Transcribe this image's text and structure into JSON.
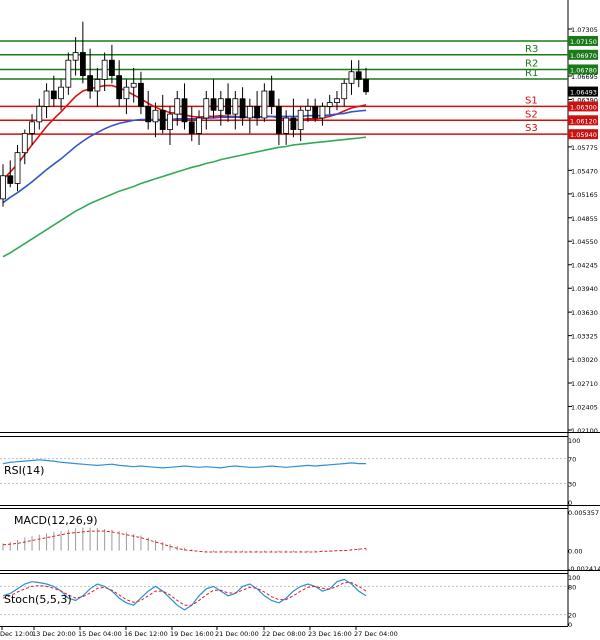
{
  "chart_data": {
    "type": "candlestick",
    "price_axis": {
      "ticks": [
        "1.07305",
        "1.06695",
        "1.06390",
        "1.05775",
        "1.05470",
        "1.05165",
        "1.04855",
        "1.04550",
        "1.04245",
        "1.03940",
        "1.03630",
        "1.03325",
        "1.03020",
        "1.02710",
        "1.02405",
        "1.02100"
      ]
    },
    "time_axis": {
      "labels": [
        "Dec 12:00",
        "13 Dec 20:00",
        "15 Dec 04:00",
        "16 Dec 12:00",
        "19 Dec 16:00",
        "21 Dec 00:00",
        "22 Dec 08:00",
        "23 Dec 16:00",
        "27 Dec 04:00"
      ]
    },
    "current_price": "1.06493",
    "levels": [
      {
        "name": "R3",
        "value": "1.06970",
        "kind": "resistance",
        "color": "#1a7a1a"
      },
      {
        "name": "R2",
        "value": "1.06780",
        "kind": "resistance",
        "color": "#1a7a1a"
      },
      {
        "name": "R1",
        "value": "",
        "kind": "resistance",
        "color": "#1a7a1a"
      },
      {
        "name": "S1",
        "value": "1.06300",
        "kind": "support",
        "color": "#cc1111"
      },
      {
        "name": "S2",
        "value": "1.06120",
        "kind": "support",
        "color": "#cc1111"
      },
      {
        "name": "S3",
        "value": "1.05940",
        "kind": "support",
        "color": "#cc1111"
      }
    ],
    "top_line": "1.07150",
    "candles": [
      [
        1.051,
        1.0555,
        1.05,
        1.054
      ],
      [
        1.054,
        1.056,
        1.0525,
        1.053
      ],
      [
        1.053,
        1.058,
        1.052,
        1.057
      ],
      [
        1.057,
        1.06,
        1.0555,
        1.0595
      ],
      [
        1.0595,
        1.062,
        1.058,
        1.061
      ],
      [
        1.061,
        1.064,
        1.06,
        1.063
      ],
      [
        1.063,
        1.066,
        1.0615,
        1.065
      ],
      [
        1.065,
        1.067,
        1.063,
        1.064
      ],
      [
        1.064,
        1.0665,
        1.0625,
        1.0655
      ],
      [
        1.0655,
        1.07,
        1.0645,
        1.069
      ],
      [
        1.069,
        1.072,
        1.067,
        1.07
      ],
      [
        1.07,
        1.074,
        1.066,
        1.067
      ],
      [
        1.067,
        1.0705,
        1.064,
        1.065
      ],
      [
        1.065,
        1.068,
        1.063,
        1.0665
      ],
      [
        1.0665,
        1.07,
        1.065,
        1.069
      ],
      [
        1.069,
        1.071,
        1.066,
        1.067
      ],
      [
        1.067,
        1.069,
        1.063,
        1.064
      ],
      [
        1.064,
        1.0665,
        1.062,
        1.0655
      ],
      [
        1.0655,
        1.068,
        1.0635,
        1.066
      ],
      [
        1.066,
        1.0675,
        1.062,
        1.063
      ],
      [
        1.063,
        1.065,
        1.06,
        1.061
      ],
      [
        1.061,
        1.0635,
        1.059,
        1.0625
      ],
      [
        1.0625,
        1.0645,
        1.0595,
        1.06
      ],
      [
        1.06,
        1.063,
        1.058,
        1.062
      ],
      [
        1.062,
        1.065,
        1.0605,
        1.064
      ],
      [
        1.064,
        1.066,
        1.06,
        1.061
      ],
      [
        1.061,
        1.063,
        1.0585,
        1.0595
      ],
      [
        1.0595,
        1.0625,
        1.058,
        1.0615
      ],
      [
        1.0615,
        1.065,
        1.06,
        1.064
      ],
      [
        1.064,
        1.0665,
        1.0615,
        1.0625
      ],
      [
        1.0625,
        1.065,
        1.0605,
        1.064
      ],
      [
        1.064,
        1.066,
        1.061,
        1.062
      ],
      [
        1.062,
        1.065,
        1.06,
        1.064
      ],
      [
        1.064,
        1.0655,
        1.0605,
        1.0615
      ],
      [
        1.0615,
        1.064,
        1.0595,
        1.063
      ],
      [
        1.063,
        1.065,
        1.0605,
        1.0615
      ],
      [
        1.0615,
        1.066,
        1.061,
        1.065
      ],
      [
        1.065,
        1.067,
        1.062,
        1.063
      ],
      [
        1.063,
        1.064,
        1.058,
        1.0595
      ],
      [
        1.0595,
        1.0625,
        1.058,
        1.0615
      ],
      [
        1.0615,
        1.064,
        1.059,
        1.06
      ],
      [
        1.06,
        1.063,
        1.0585,
        1.0625
      ],
      [
        1.0625,
        1.064,
        1.061,
        1.063
      ],
      [
        1.063,
        1.064,
        1.061,
        1.0615
      ],
      [
        1.0615,
        1.0635,
        1.0605,
        1.063
      ],
      [
        1.063,
        1.0645,
        1.062,
        1.0635
      ],
      [
        1.0635,
        1.065,
        1.0625,
        1.064
      ],
      [
        1.064,
        1.0665,
        1.063,
        1.066
      ],
      [
        1.066,
        1.069,
        1.0645,
        1.0675
      ],
      [
        1.0675,
        1.069,
        1.0655,
        1.0665
      ],
      [
        1.0665,
        1.068,
        1.0645,
        1.0649
      ]
    ],
    "moving_averages": [
      {
        "color": "#dd1111",
        "values": [
          1.0535,
          1.0545,
          1.0555,
          1.0568,
          1.058,
          1.0592,
          1.0604,
          1.0614,
          1.0623,
          1.0633,
          1.0643,
          1.065,
          1.0653,
          1.0655,
          1.0657,
          1.0657,
          1.0654,
          1.065,
          1.0645,
          1.064,
          1.0634,
          1.0629,
          1.0625,
          1.0622,
          1.0621,
          1.0619,
          1.0617,
          1.0616,
          1.0617,
          1.0617,
          1.0618,
          1.0617,
          1.0617,
          1.0616,
          1.0616,
          1.0616,
          1.0617,
          1.0617,
          1.0615,
          1.0614,
          1.0613,
          1.0613,
          1.0614,
          1.0614,
          1.0615,
          1.0617,
          1.062,
          1.0624,
          1.0628,
          1.063,
          1.0632
        ]
      },
      {
        "color": "#3355cc",
        "values": [
          1.0505,
          1.0512,
          1.0518,
          1.0525,
          1.0532,
          1.054,
          1.0548,
          1.0555,
          1.0562,
          1.057,
          1.0578,
          1.0585,
          1.0591,
          1.0596,
          1.0601,
          1.0605,
          1.0608,
          1.061,
          1.0612,
          1.0613,
          1.0613,
          1.0613,
          1.0613,
          1.0613,
          1.0614,
          1.0614,
          1.0614,
          1.0614,
          1.0615,
          1.0615,
          1.0616,
          1.0616,
          1.0616,
          1.0616,
          1.0616,
          1.0616,
          1.0617,
          1.0617,
          1.0617,
          1.0617,
          1.0617,
          1.0617,
          1.0618,
          1.0618,
          1.0618,
          1.0619,
          1.062,
          1.0621,
          1.0623,
          1.0624,
          1.0625
        ]
      },
      {
        "color": "#33aa55",
        "values": [
          1.0435,
          1.044,
          1.0446,
          1.0452,
          1.0458,
          1.0464,
          1.047,
          1.0476,
          1.0482,
          1.0488,
          1.0494,
          1.0499,
          1.0504,
          1.0508,
          1.0512,
          1.0516,
          1.052,
          1.0523,
          1.0526,
          1.053,
          1.0533,
          1.0536,
          1.0539,
          1.0542,
          1.0545,
          1.0548,
          1.0551,
          1.0553,
          1.0556,
          1.0558,
          1.0561,
          1.0563,
          1.0565,
          1.0567,
          1.0569,
          1.0571,
          1.0573,
          1.0575,
          1.0577,
          1.0578,
          1.058,
          1.0581,
          1.0582,
          1.0583,
          1.0584,
          1.0585,
          1.0586,
          1.0587,
          1.0588,
          1.0589,
          1.059
        ]
      }
    ],
    "rsi": {
      "label": "RSI(14)",
      "ticks": [
        "100",
        "70",
        "30",
        "0"
      ],
      "values": [
        62,
        64,
        65,
        66,
        67,
        68,
        67,
        66,
        64,
        63,
        62,
        61,
        60,
        59,
        60,
        61,
        59,
        58,
        57,
        58,
        57,
        56,
        55,
        56,
        57,
        58,
        57,
        56,
        57,
        56,
        55,
        57,
        58,
        57,
        56,
        56,
        57,
        58,
        57,
        56,
        57,
        58,
        59,
        58,
        59,
        60,
        61,
        62,
        63,
        62,
        62
      ]
    },
    "macd": {
      "label": "MACD(12,26,9)",
      "ticks": [
        "0.005357",
        "0.00",
        "-0.002414"
      ],
      "histogram": [
        0.001,
        0.0012,
        0.0015,
        0.0018,
        0.002,
        0.0022,
        0.0024,
        0.0026,
        0.0027,
        0.0029,
        0.0031,
        0.0032,
        0.0032,
        0.0031,
        0.003,
        0.0029,
        0.0027,
        0.0025,
        0.0023,
        0.0021,
        0.0018,
        0.0015,
        0.0012,
        0.0009,
        0.0006,
        0.0004,
        0.0002,
        0.0,
        -0.0001,
        -0.0002,
        -0.0002,
        -0.0002,
        -0.0002,
        -0.0002,
        -0.0002,
        -0.0002,
        -0.0002,
        -0.0002,
        -0.0002,
        -0.0002,
        -0.0002,
        -0.0002,
        -0.0002,
        -0.0002,
        -0.0001,
        -0.0001,
        0.0,
        0.0001,
        0.0002,
        0.0003,
        0.0004
      ],
      "signal": [
        0.0008,
        0.0009,
        0.001,
        0.0012,
        0.0014,
        0.0016,
        0.0018,
        0.002,
        0.0022,
        0.0024,
        0.0025,
        0.0026,
        0.0027,
        0.0027,
        0.0027,
        0.0026,
        0.0024,
        0.0022,
        0.002,
        0.0018,
        0.0015,
        0.0012,
        0.0009,
        0.0006,
        0.0003,
        0.0001,
        0.0,
        -0.0001,
        -0.0002,
        -0.0002,
        -0.0002,
        -0.0002,
        -0.0002,
        -0.0002,
        -0.0002,
        -0.0002,
        -0.0002,
        -0.0002,
        -0.0002,
        -0.0002,
        -0.0002,
        -0.0002,
        -0.0002,
        -0.0002,
        -0.0001,
        -0.0001,
        0.0,
        0.0,
        0.0001,
        0.0002,
        0.0003
      ]
    },
    "stoch": {
      "label": "Stoch(5,5,3)",
      "ticks": [
        "100",
        "80",
        "20",
        "0"
      ],
      "k": [
        60,
        65,
        75,
        85,
        90,
        88,
        85,
        80,
        70,
        55,
        50,
        60,
        75,
        85,
        80,
        70,
        55,
        45,
        40,
        55,
        70,
        80,
        70,
        55,
        40,
        30,
        40,
        60,
        75,
        80,
        70,
        60,
        65,
        80,
        85,
        75,
        60,
        50,
        45,
        55,
        70,
        80,
        85,
        80,
        70,
        75,
        90,
        95,
        85,
        70,
        60
      ],
      "d": [
        55,
        60,
        68,
        75,
        80,
        82,
        80,
        76,
        70,
        62,
        55,
        58,
        66,
        76,
        78,
        72,
        62,
        52,
        46,
        50,
        60,
        70,
        70,
        62,
        50,
        40,
        40,
        50,
        62,
        72,
        72,
        66,
        66,
        72,
        78,
        76,
        68,
        58,
        52,
        52,
        60,
        70,
        78,
        80,
        76,
        74,
        80,
        88,
        88,
        80,
        70
      ]
    }
  }
}
